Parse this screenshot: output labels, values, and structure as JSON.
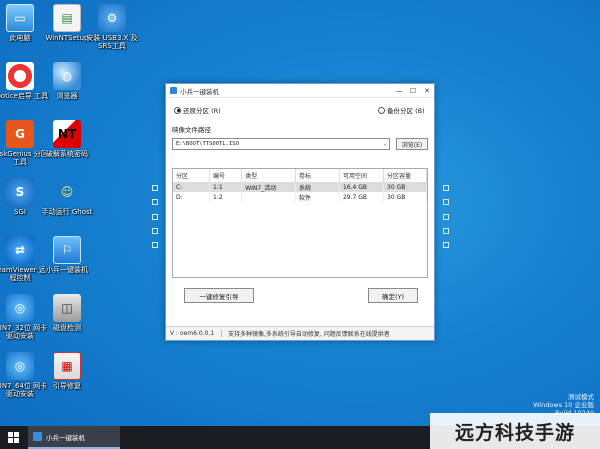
{
  "desktop_icons": [
    {
      "label": "此电脑",
      "glyph": "▭",
      "icon": "computer-icon"
    },
    {
      "label": "WinNTSetup",
      "glyph": "▤",
      "icon": "winntsetup-icon"
    },
    {
      "label": "安装 USB3.X 及SRS工具",
      "glyph": "⚙",
      "icon": "usb-tool-icon"
    },
    {
      "label": "Bootice启导 工具",
      "glyph": "✚",
      "icon": "bootice-icon"
    },
    {
      "label": "浏览器",
      "glyph": "◍",
      "icon": "browser-icon"
    },
    {
      "label": "DiskGenius 分区工具",
      "glyph": "G",
      "icon": "diskgenius-icon"
    },
    {
      "label": "破解系统密码",
      "glyph": "NT",
      "icon": "nt-password-icon"
    },
    {
      "label": "SGI",
      "glyph": "S",
      "icon": "sgi-icon"
    },
    {
      "label": "手动运行 Ghost",
      "glyph": "☺",
      "icon": "ghost-icon"
    },
    {
      "label": "TeamViewer 远程控制",
      "glyph": "⇄",
      "icon": "teamviewer-icon"
    },
    {
      "label": "小兵一键装机",
      "glyph": "⚐",
      "icon": "xiaobing-icon"
    },
    {
      "label": "WIN7_32位 网卡驱动安装",
      "glyph": "◎",
      "icon": "win7-32-driver-icon"
    },
    {
      "label": "磁盘检测",
      "glyph": "◫",
      "icon": "disk-check-icon"
    },
    {
      "label": "WIN7_64位 网卡驱动安装",
      "glyph": "◎",
      "icon": "win7-64-driver-icon"
    },
    {
      "label": "引导修复",
      "glyph": "▦",
      "icon": "boot-repair-icon"
    }
  ],
  "window": {
    "title": "小兵一键装机",
    "minimize": "—",
    "maximize": "☐",
    "close": "✕",
    "radio_restore": "还原分区 (R)",
    "radio_backup": "备份分区 (B)",
    "image_label": "映像文件路径",
    "image_path": "E:\\BOOT\\TTS00TL.ISO",
    "browse_label": "浏览(E)",
    "table": {
      "headers": [
        "分区",
        "编号",
        "类型",
        "卷标",
        "可用空间",
        "分区容量"
      ],
      "rows": [
        [
          "C:",
          "1:1",
          "WIN7_活动",
          "系统",
          "16.4 GB",
          "30 GB"
        ],
        [
          "D:",
          "1:2",
          "",
          "软件",
          "29.7 GB",
          "30 GB"
        ]
      ]
    },
    "repair_button": "一键修复引导",
    "ok_button": "确定(Y)",
    "status_version": "V : oem6.0.0.1",
    "status_message": "支持多种镜像,多系统引导自动修复, 问题反馈联系在线提供者"
  },
  "test_mode": {
    "line1": "测试模式",
    "line2": "Windows 10 企业版",
    "line3": "Build 10240"
  },
  "taskbar": {
    "task_label": "小兵一键装机"
  },
  "watermark": "远方科技手游"
}
